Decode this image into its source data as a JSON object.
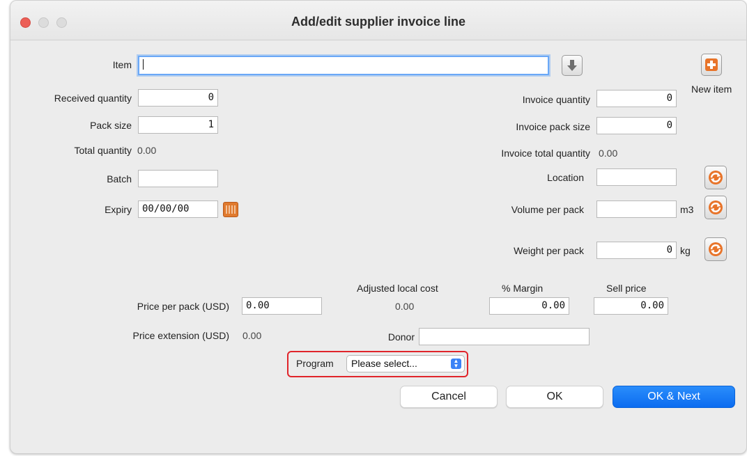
{
  "window": {
    "title": "Add/edit supplier invoice line"
  },
  "item": {
    "label": "Item",
    "value": ""
  },
  "new_item": {
    "label": "New item"
  },
  "received_quantity": {
    "label": "Received quantity",
    "value": "0"
  },
  "pack_size": {
    "label": "Pack size",
    "value": "1"
  },
  "total_quantity": {
    "label": "Total quantity",
    "value": "0.00"
  },
  "batch": {
    "label": "Batch",
    "value": ""
  },
  "expiry": {
    "label": "Expiry",
    "value": "00/00/00"
  },
  "invoice_quantity": {
    "label": "Invoice quantity",
    "value": "0"
  },
  "invoice_pack_size": {
    "label": "Invoice pack size",
    "value": "0"
  },
  "invoice_total_quantity": {
    "label": "Invoice total quantity",
    "value": "0.00"
  },
  "location": {
    "label": "Location",
    "value": ""
  },
  "volume_per_pack": {
    "label": "Volume per pack",
    "value": "",
    "unit": "m3"
  },
  "weight_per_pack": {
    "label": "Weight per pack",
    "value": "0",
    "unit": "kg"
  },
  "price_per_pack": {
    "label": "Price per pack (USD)",
    "value": "0.00"
  },
  "adjusted_local_cost": {
    "label": "Adjusted local cost",
    "value": "0.00"
  },
  "margin": {
    "label": "% Margin",
    "value": "0.00"
  },
  "sell_price": {
    "label": "Sell price",
    "value": "0.00"
  },
  "price_extension": {
    "label": "Price extension (USD)",
    "value": "0.00"
  },
  "donor": {
    "label": "Donor",
    "value": ""
  },
  "program": {
    "label": "Program",
    "selected": "Please select..."
  },
  "buttons": {
    "cancel": "Cancel",
    "ok": "OK",
    "ok_next": "OK & Next"
  },
  "colors": {
    "accent": "#0b6cf0",
    "highlight": "#e0242a",
    "icon_orange": "#e07a2e"
  }
}
